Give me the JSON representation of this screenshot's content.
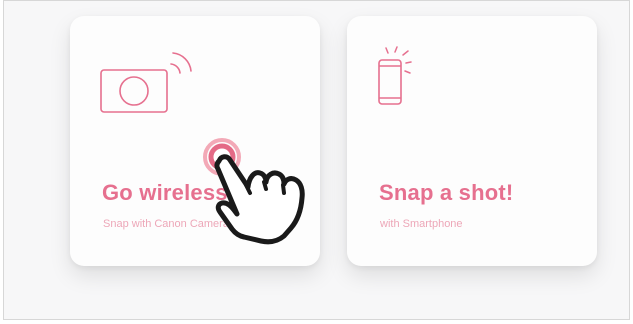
{
  "colors": {
    "accent": "#e6708f",
    "accent_light": "#eda7b8",
    "card_bg": "#fdfdfd",
    "page_bg": "#f7f7f8"
  },
  "cards": [
    {
      "title": "Go wireless!",
      "subtitle": "Snap with Canon Camera",
      "icon": "camera-wireless-icon"
    },
    {
      "title": "Snap a shot!",
      "subtitle": "with Smartphone",
      "icon": "smartphone-icon"
    }
  ],
  "overlay": {
    "icon": "hand-pointer-cursor-icon"
  }
}
